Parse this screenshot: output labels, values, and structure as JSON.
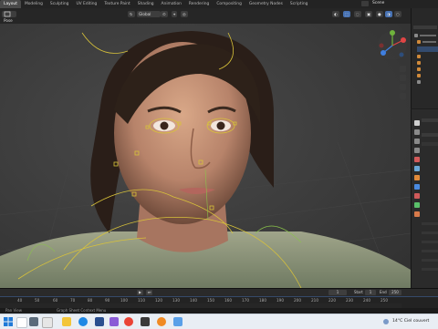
{
  "workspace_tabs": [
    "Layout",
    "Modeling",
    "Sculpting",
    "UV Editing",
    "Texture Paint",
    "Shading",
    "Animation",
    "Rendering",
    "Compositing",
    "Geometry Nodes",
    "Scripting"
  ],
  "active_tab": "Layout",
  "viewport": {
    "mode": "Pose",
    "orientation": "Global",
    "pose_options": "Pose Options"
  },
  "outliner": {
    "title": "Scene"
  },
  "timeline": {
    "ticks": [
      "40",
      "50",
      "60",
      "70",
      "80",
      "90",
      "100",
      "110",
      "120",
      "130",
      "140",
      "150",
      "160",
      "170",
      "180",
      "190",
      "200",
      "210",
      "220",
      "230",
      "240",
      "250"
    ],
    "current_frame": "1",
    "start_label": "Start",
    "start_value": "1",
    "end_label": "End",
    "end_value": "250"
  },
  "status_bar": {
    "left": "Pan View",
    "center": "Graph Sheet Context Menu"
  },
  "taskbar": {
    "weather": "14°C  Ciel couvert"
  },
  "colors": {
    "accent": "#4772b3",
    "bone_yellow": "#d8c23a",
    "active_tab_bg": "#4a4a4a",
    "taskbar_bg": "#e9eef4"
  }
}
